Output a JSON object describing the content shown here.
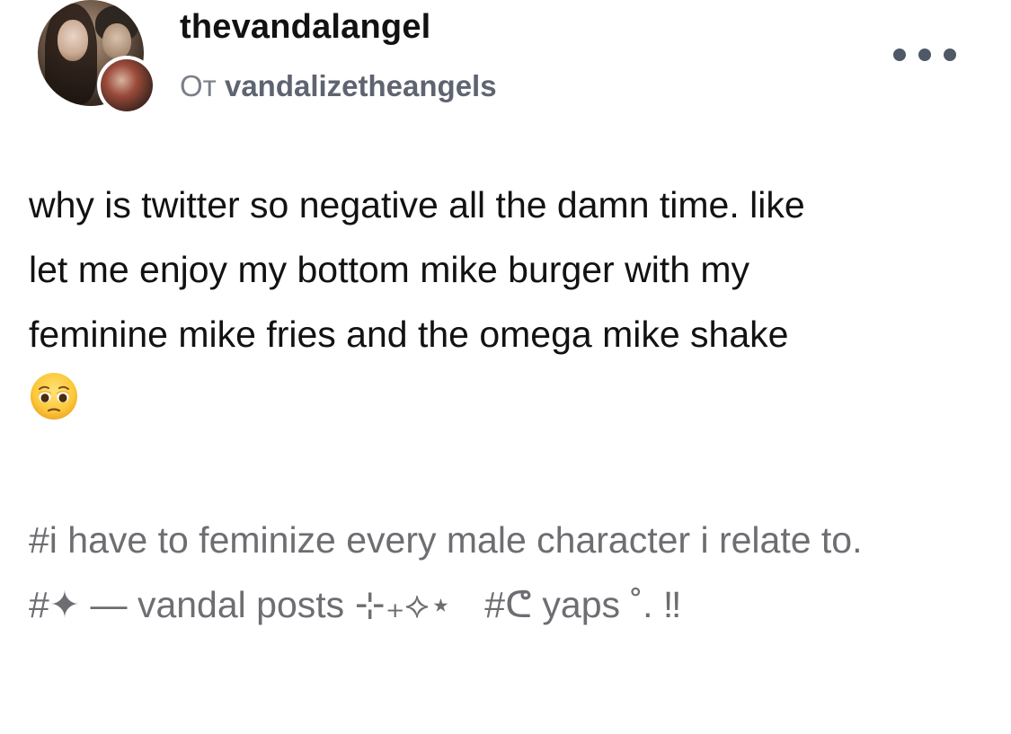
{
  "post": {
    "author": {
      "username": "thevandalangel",
      "reblog_prefix": "От",
      "reblog_source": "vandalizetheangels"
    },
    "more_icon": "more-dots-icon",
    "body_lines": [
      "why is twitter so negative all the damn time. like",
      "let me enjoy my bottom mike burger with my",
      "feminine mike fries and the omega mike shake"
    ],
    "emoji": "pleading-face-emoji",
    "tags": [
      "#i have to feminize every male character i relate to.",
      "#✦ — vandal posts ⊹₊⟡⋆",
      "#ᕦ yaps ˚. ‼"
    ]
  },
  "colors": {
    "text": "#121212",
    "muted": "#7a7f88",
    "tag": "#6d6d72",
    "dots": "#4f5966"
  }
}
